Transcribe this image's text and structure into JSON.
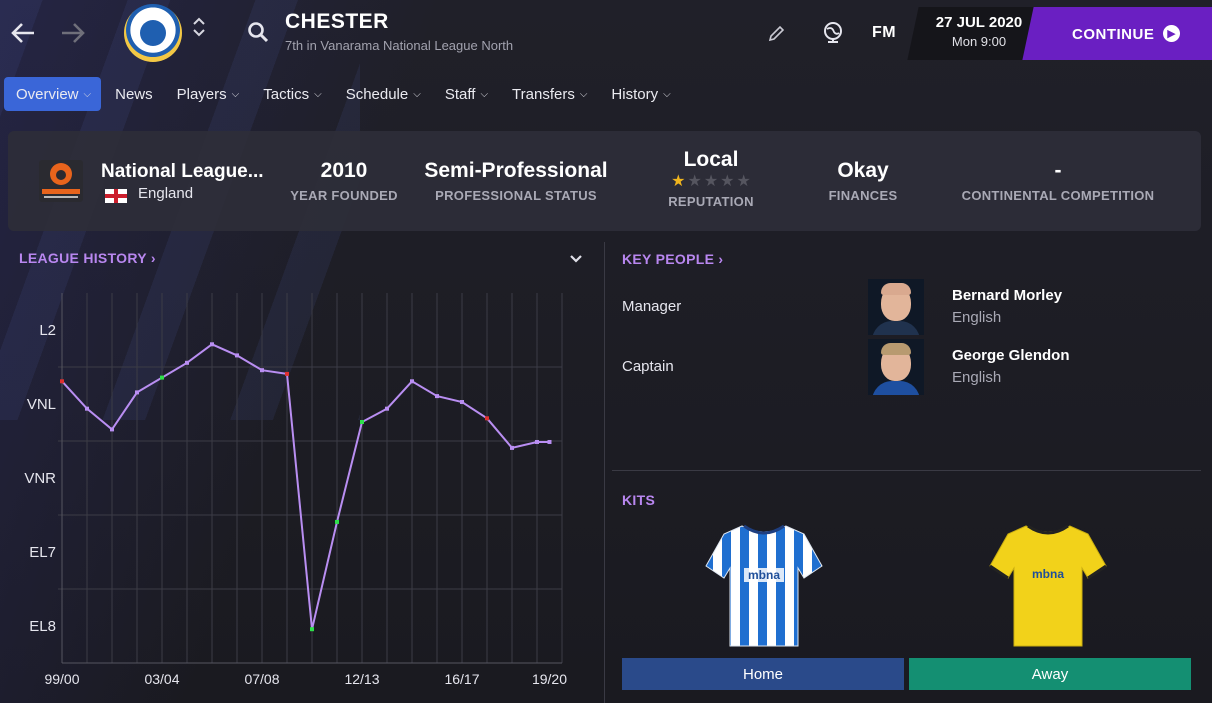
{
  "header": {
    "club_name": "CHESTER",
    "club_subtitle": "7th in Vanarama National League North",
    "fm_logo": "FM",
    "date": "27 JUL 2020",
    "time": "Mon 9:00",
    "continue_label": "CONTINUE",
    "icons": [
      "back-arrow-icon",
      "forward-arrow-icon",
      "club-crest",
      "search-icon",
      "pencil-icon",
      "globe-icon",
      "play-circle-icon"
    ]
  },
  "tabs": [
    {
      "label": "Overview",
      "has_menu": true,
      "active": true
    },
    {
      "label": "News",
      "has_menu": false,
      "active": false
    },
    {
      "label": "Players",
      "has_menu": true,
      "active": false
    },
    {
      "label": "Tactics",
      "has_menu": true,
      "active": false
    },
    {
      "label": "Schedule",
      "has_menu": true,
      "active": false
    },
    {
      "label": "Staff",
      "has_menu": true,
      "active": false
    },
    {
      "label": "Transfers",
      "has_menu": true,
      "active": false
    },
    {
      "label": "History",
      "has_menu": true,
      "active": false
    }
  ],
  "info": {
    "league_name": "National League...",
    "country": "England",
    "year_founded": {
      "value": "2010",
      "label": "YEAR FOUNDED"
    },
    "status": {
      "value": "Semi-Professional",
      "label": "PROFESSIONAL STATUS"
    },
    "reputation": {
      "value": "Local",
      "label": "REPUTATION",
      "stars": 1,
      "max_stars": 5
    },
    "finances": {
      "value": "Okay",
      "label": "FINANCES"
    },
    "continental": {
      "value": "-",
      "label": "CONTINENTAL COMPETITION"
    }
  },
  "league_history": {
    "title": "LEAGUE HISTORY",
    "chevron": "›"
  },
  "chart_data": {
    "type": "line",
    "y_levels": [
      "L2",
      "VNL",
      "VNR",
      "EL7",
      "EL8"
    ],
    "x_labels": [
      "99/00",
      "03/04",
      "07/08",
      "12/13",
      "16/17",
      "19/20"
    ],
    "x_label_seasons": [
      0,
      4,
      8,
      12,
      16,
      19.5
    ],
    "seasons_count": 20,
    "series": [
      {
        "x": [
          0,
          1,
          2,
          3,
          4,
          5,
          6,
          7,
          8,
          9,
          10,
          11,
          12,
          13,
          14,
          15,
          16,
          17,
          18,
          19,
          19.5
        ],
        "y": [
          1.45,
          1.82,
          2.1,
          1.6,
          1.4,
          1.2,
          0.95,
          1.1,
          1.3,
          1.35,
          4.8,
          3.35,
          2.0,
          1.82,
          1.45,
          1.65,
          1.73,
          1.95,
          2.35,
          2.27,
          2.27
        ],
        "marker_colors": [
          "#e03030",
          "#b98ef2",
          "#b98ef2",
          "#b98ef2",
          "#2ee04a",
          "#b98ef2",
          "#b98ef2",
          "#b98ef2",
          "#b98ef2",
          "#e03030",
          "#2ee04a",
          "#2ee04a",
          "#2ee04a",
          "#b98ef2",
          "#b98ef2",
          "#b98ef2",
          "#b98ef2",
          "#e03030",
          "#b98ef2",
          "#b98ef2",
          "#b98ef2"
        ]
      }
    ],
    "line_color": "#b98ef2",
    "grid": true
  },
  "key_people": {
    "title": "KEY PEOPLE",
    "chevron": "›",
    "people": [
      {
        "role": "Manager",
        "name": "Bernard Morley",
        "nationality": "English"
      },
      {
        "role": "Captain",
        "name": "George Glendon",
        "nationality": "English"
      }
    ]
  },
  "kits": {
    "title": "KITS",
    "sponsor": "mbna",
    "home_label": "Home",
    "away_label": "Away",
    "colors": {
      "home_primary": "#1f6fd0",
      "home_secondary": "#ffffff",
      "away_primary": "#f2d21a",
      "home_button": "#2a4a8a",
      "away_button": "#148f72"
    }
  },
  "colors": {
    "accent": "#6a1fc2",
    "tab_active": "#3a66d8",
    "section_title": "#b987f0"
  }
}
